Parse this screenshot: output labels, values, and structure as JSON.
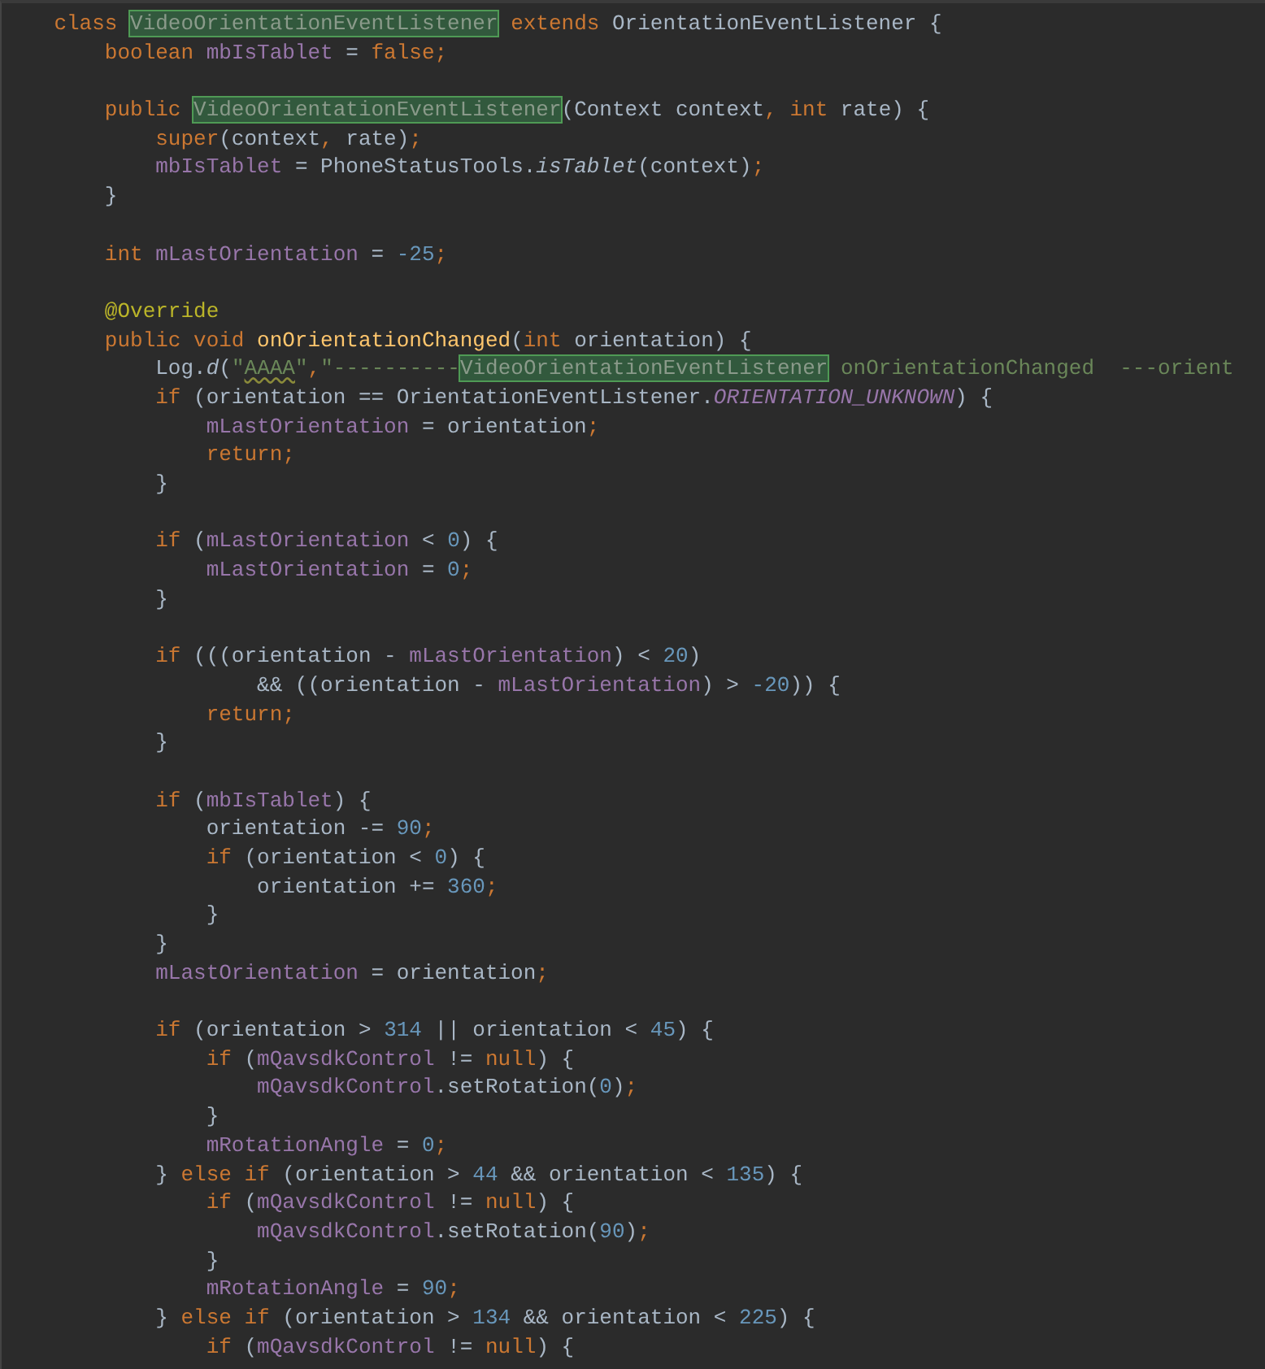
{
  "editor": {
    "lines": [
      {
        "kind": "code",
        "tokens": [
          {
            "kind": "keyword",
            "text": "    class "
          },
          {
            "kind": "match",
            "text": "VideoOrientationEventListener"
          },
          {
            "kind": "keyword",
            "text": " extends "
          },
          {
            "kind": "plain",
            "text": "OrientationEventListener {"
          }
        ]
      },
      {
        "kind": "code",
        "tokens": [
          {
            "kind": "keyword",
            "text": "        boolean "
          },
          {
            "kind": "field",
            "text": "mbIsTablet"
          },
          {
            "kind": "plain",
            "text": " = "
          },
          {
            "kind": "keyword",
            "text": "false;"
          }
        ]
      },
      {
        "kind": "blank"
      },
      {
        "kind": "code",
        "tokens": [
          {
            "kind": "keyword",
            "text": "        public "
          },
          {
            "kind": "match",
            "text": "VideoOrientationEventListener"
          },
          {
            "kind": "plain",
            "text": "(Context context"
          },
          {
            "kind": "keyword",
            "text": ", int "
          },
          {
            "kind": "plain",
            "text": "rate) {"
          }
        ]
      },
      {
        "kind": "code",
        "tokens": [
          {
            "kind": "keyword",
            "text": "            super"
          },
          {
            "kind": "plain",
            "text": "(context"
          },
          {
            "kind": "keyword",
            "text": ", "
          },
          {
            "kind": "plain",
            "text": "rate)"
          },
          {
            "kind": "keyword",
            "text": ";"
          }
        ]
      },
      {
        "kind": "code",
        "tokens": [
          {
            "kind": "field",
            "text": "            mbIsTablet"
          },
          {
            "kind": "plain",
            "text": " = PhoneStatusTools."
          },
          {
            "kind": "italic",
            "text": "isTablet"
          },
          {
            "kind": "plain",
            "text": "(context)"
          },
          {
            "kind": "keyword",
            "text": ";"
          }
        ]
      },
      {
        "kind": "code",
        "tokens": [
          {
            "kind": "plain",
            "text": "        }"
          }
        ]
      },
      {
        "kind": "blank"
      },
      {
        "kind": "code",
        "tokens": [
          {
            "kind": "keyword",
            "text": "        int "
          },
          {
            "kind": "field",
            "text": "mLastOrientation"
          },
          {
            "kind": "plain",
            "text": " = "
          },
          {
            "kind": "number",
            "text": "-25"
          },
          {
            "kind": "keyword",
            "text": ";"
          }
        ]
      },
      {
        "kind": "blank"
      },
      {
        "kind": "code",
        "tokens": [
          {
            "kind": "annotation",
            "text": "        @Override"
          }
        ]
      },
      {
        "kind": "code",
        "tokens": [
          {
            "kind": "keyword",
            "text": "        public void "
          },
          {
            "kind": "method",
            "text": "onOrientationChanged"
          },
          {
            "kind": "plain",
            "text": "("
          },
          {
            "kind": "keyword",
            "text": "int "
          },
          {
            "kind": "plain",
            "text": "orientation) {"
          }
        ]
      },
      {
        "kind": "code",
        "tokens": [
          {
            "kind": "plain",
            "text": "            Log."
          },
          {
            "kind": "italic",
            "text": "d"
          },
          {
            "kind": "plain",
            "text": "("
          },
          {
            "kind": "string",
            "text": "\""
          },
          {
            "kind": "typo",
            "text": "AAAA"
          },
          {
            "kind": "string",
            "text": "\""
          },
          {
            "kind": "keyword",
            "text": ","
          },
          {
            "kind": "string",
            "text": "\"----------"
          },
          {
            "kind": "match",
            "text": "VideoOrientationEventListener"
          },
          {
            "kind": "string",
            "text": " onOrientationChanged  ---orient"
          }
        ]
      },
      {
        "kind": "code",
        "tokens": [
          {
            "kind": "keyword",
            "text": "            if "
          },
          {
            "kind": "plain",
            "text": "(orientation == OrientationEventListener."
          },
          {
            "kind": "constant",
            "text": "ORIENTATION_UNKNOWN"
          },
          {
            "kind": "plain",
            "text": ") {"
          }
        ]
      },
      {
        "kind": "code",
        "tokens": [
          {
            "kind": "field",
            "text": "                mLastOrientation"
          },
          {
            "kind": "plain",
            "text": " = orientation"
          },
          {
            "kind": "keyword",
            "text": ";"
          }
        ]
      },
      {
        "kind": "code",
        "tokens": [
          {
            "kind": "keyword",
            "text": "                return;"
          }
        ]
      },
      {
        "kind": "code",
        "tokens": [
          {
            "kind": "plain",
            "text": "            }"
          }
        ]
      },
      {
        "kind": "blank"
      },
      {
        "kind": "code",
        "tokens": [
          {
            "kind": "keyword",
            "text": "            if "
          },
          {
            "kind": "plain",
            "text": "("
          },
          {
            "kind": "field",
            "text": "mLastOrientation"
          },
          {
            "kind": "plain",
            "text": " < "
          },
          {
            "kind": "number",
            "text": "0"
          },
          {
            "kind": "plain",
            "text": ") {"
          }
        ]
      },
      {
        "kind": "code",
        "tokens": [
          {
            "kind": "field",
            "text": "                mLastOrientation"
          },
          {
            "kind": "plain",
            "text": " = "
          },
          {
            "kind": "number",
            "text": "0"
          },
          {
            "kind": "keyword",
            "text": ";"
          }
        ]
      },
      {
        "kind": "code",
        "tokens": [
          {
            "kind": "plain",
            "text": "            }"
          }
        ]
      },
      {
        "kind": "blank"
      },
      {
        "kind": "code",
        "tokens": [
          {
            "kind": "keyword",
            "text": "            if "
          },
          {
            "kind": "plain",
            "text": "(((orientation - "
          },
          {
            "kind": "field",
            "text": "mLastOrientation"
          },
          {
            "kind": "plain",
            "text": ") < "
          },
          {
            "kind": "number",
            "text": "20"
          },
          {
            "kind": "plain",
            "text": ")"
          }
        ]
      },
      {
        "kind": "code",
        "tokens": [
          {
            "kind": "plain",
            "text": "                    && ((orientation - "
          },
          {
            "kind": "field",
            "text": "mLastOrientation"
          },
          {
            "kind": "plain",
            "text": ") > "
          },
          {
            "kind": "number",
            "text": "-20"
          },
          {
            "kind": "plain",
            "text": ")) {"
          }
        ]
      },
      {
        "kind": "code",
        "tokens": [
          {
            "kind": "keyword",
            "text": "                return;"
          }
        ]
      },
      {
        "kind": "code",
        "tokens": [
          {
            "kind": "plain",
            "text": "            }"
          }
        ]
      },
      {
        "kind": "blank"
      },
      {
        "kind": "code",
        "tokens": [
          {
            "kind": "keyword",
            "text": "            if "
          },
          {
            "kind": "plain",
            "text": "("
          },
          {
            "kind": "field",
            "text": "mbIsTablet"
          },
          {
            "kind": "plain",
            "text": ") {"
          }
        ]
      },
      {
        "kind": "code",
        "tokens": [
          {
            "kind": "plain",
            "text": "                orientation -= "
          },
          {
            "kind": "number",
            "text": "90"
          },
          {
            "kind": "keyword",
            "text": ";"
          }
        ]
      },
      {
        "kind": "code",
        "tokens": [
          {
            "kind": "keyword",
            "text": "                if "
          },
          {
            "kind": "plain",
            "text": "(orientation < "
          },
          {
            "kind": "number",
            "text": "0"
          },
          {
            "kind": "plain",
            "text": ") {"
          }
        ]
      },
      {
        "kind": "code",
        "tokens": [
          {
            "kind": "plain",
            "text": "                    orientation += "
          },
          {
            "kind": "number",
            "text": "360"
          },
          {
            "kind": "keyword",
            "text": ";"
          }
        ]
      },
      {
        "kind": "code",
        "tokens": [
          {
            "kind": "plain",
            "text": "                }"
          }
        ]
      },
      {
        "kind": "code",
        "tokens": [
          {
            "kind": "plain",
            "text": "            }"
          }
        ]
      },
      {
        "kind": "code",
        "tokens": [
          {
            "kind": "field",
            "text": "            mLastOrientation"
          },
          {
            "kind": "plain",
            "text": " = orientation"
          },
          {
            "kind": "keyword",
            "text": ";"
          }
        ]
      },
      {
        "kind": "blank"
      },
      {
        "kind": "code",
        "tokens": [
          {
            "kind": "keyword",
            "text": "            if "
          },
          {
            "kind": "plain",
            "text": "(orientation > "
          },
          {
            "kind": "number",
            "text": "314"
          },
          {
            "kind": "plain",
            "text": " || orientation < "
          },
          {
            "kind": "number",
            "text": "45"
          },
          {
            "kind": "plain",
            "text": ") {"
          }
        ]
      },
      {
        "kind": "code",
        "tokens": [
          {
            "kind": "keyword",
            "text": "                if "
          },
          {
            "kind": "plain",
            "text": "("
          },
          {
            "kind": "field",
            "text": "mQavsdkControl"
          },
          {
            "kind": "plain",
            "text": " != "
          },
          {
            "kind": "keyword",
            "text": "null"
          },
          {
            "kind": "plain",
            "text": ") {"
          }
        ]
      },
      {
        "kind": "code",
        "tokens": [
          {
            "kind": "field",
            "text": "                    mQavsdkControl"
          },
          {
            "kind": "plain",
            "text": ".setRotation("
          },
          {
            "kind": "number",
            "text": "0"
          },
          {
            "kind": "plain",
            "text": ")"
          },
          {
            "kind": "keyword",
            "text": ";"
          }
        ]
      },
      {
        "kind": "code",
        "tokens": [
          {
            "kind": "plain",
            "text": "                }"
          }
        ]
      },
      {
        "kind": "code",
        "tokens": [
          {
            "kind": "field",
            "text": "                mRotationAngle"
          },
          {
            "kind": "plain",
            "text": " = "
          },
          {
            "kind": "number",
            "text": "0"
          },
          {
            "kind": "keyword",
            "text": ";"
          }
        ]
      },
      {
        "kind": "code",
        "tokens": [
          {
            "kind": "plain",
            "text": "            } "
          },
          {
            "kind": "keyword",
            "text": "else if "
          },
          {
            "kind": "plain",
            "text": "(orientation > "
          },
          {
            "kind": "number",
            "text": "44"
          },
          {
            "kind": "plain",
            "text": " && orientation < "
          },
          {
            "kind": "number",
            "text": "135"
          },
          {
            "kind": "plain",
            "text": ") {"
          }
        ]
      },
      {
        "kind": "code",
        "tokens": [
          {
            "kind": "keyword",
            "text": "                if "
          },
          {
            "kind": "plain",
            "text": "("
          },
          {
            "kind": "field",
            "text": "mQavsdkControl"
          },
          {
            "kind": "plain",
            "text": " != "
          },
          {
            "kind": "keyword",
            "text": "null"
          },
          {
            "kind": "plain",
            "text": ") {"
          }
        ]
      },
      {
        "kind": "code",
        "tokens": [
          {
            "kind": "field",
            "text": "                    mQavsdkControl"
          },
          {
            "kind": "plain",
            "text": ".setRotation("
          },
          {
            "kind": "number",
            "text": "90"
          },
          {
            "kind": "plain",
            "text": ")"
          },
          {
            "kind": "keyword",
            "text": ";"
          }
        ]
      },
      {
        "kind": "code",
        "tokens": [
          {
            "kind": "plain",
            "text": "                }"
          }
        ]
      },
      {
        "kind": "code",
        "tokens": [
          {
            "kind": "field",
            "text": "                mRotationAngle"
          },
          {
            "kind": "plain",
            "text": " = "
          },
          {
            "kind": "number",
            "text": "90"
          },
          {
            "kind": "keyword",
            "text": ";"
          }
        ]
      },
      {
        "kind": "code",
        "tokens": [
          {
            "kind": "plain",
            "text": "            } "
          },
          {
            "kind": "keyword",
            "text": "else if "
          },
          {
            "kind": "plain",
            "text": "(orientation > "
          },
          {
            "kind": "number",
            "text": "134"
          },
          {
            "kind": "plain",
            "text": " && orientation < "
          },
          {
            "kind": "number",
            "text": "225"
          },
          {
            "kind": "plain",
            "text": ") {"
          }
        ]
      },
      {
        "kind": "code",
        "tokens": [
          {
            "kind": "keyword",
            "text": "                if "
          },
          {
            "kind": "plain",
            "text": "("
          },
          {
            "kind": "field",
            "text": "mQavsdkControl"
          },
          {
            "kind": "plain",
            "text": " != "
          },
          {
            "kind": "keyword",
            "text": "null"
          },
          {
            "kind": "plain",
            "text": ") {"
          }
        ]
      }
    ]
  }
}
